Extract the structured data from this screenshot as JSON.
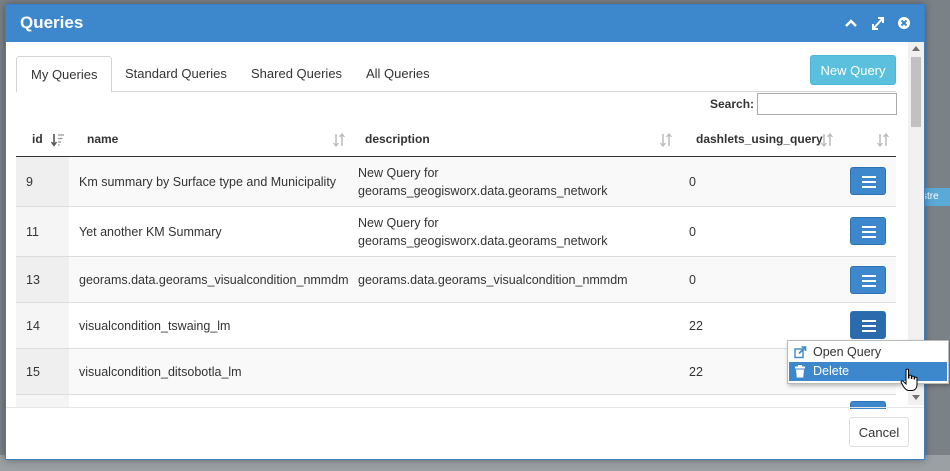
{
  "dialog": {
    "title": "Queries"
  },
  "background": {
    "tag_text": "stre"
  },
  "tabs": [
    {
      "label": "My Queries",
      "active": true
    },
    {
      "label": "Standard Queries",
      "active": false
    },
    {
      "label": "Shared Queries",
      "active": false
    },
    {
      "label": "All Queries",
      "active": false
    }
  ],
  "toolbar": {
    "new_query_label": "New Query"
  },
  "search": {
    "label": "Search:",
    "value": ""
  },
  "table": {
    "columns": [
      "id",
      "name",
      "description",
      "dashlets_using_query"
    ],
    "rows": [
      {
        "id": "9",
        "name": "Km summary by Surface type and Municipality",
        "description_1": "New Query for",
        "description_2": "georams_geogisworx.data.georams_network",
        "dashlets": "0"
      },
      {
        "id": "11",
        "name": "Yet another KM Summary",
        "description_1": "New Query for",
        "description_2": "georams_geogisworx.data.georams_network",
        "dashlets": "0"
      },
      {
        "id": "13",
        "name": "georams.data.georams_visualcondition_nmmdm",
        "description_1": "georams.data.georams_visualcondition_nmmdm",
        "description_2": "",
        "dashlets": "0"
      },
      {
        "id": "14",
        "name": "visualcondition_tswaing_lm",
        "description_1": "",
        "description_2": "",
        "dashlets": "22"
      },
      {
        "id": "15",
        "name": "visualcondition_ditsobotla_lm",
        "description_1": "",
        "description_2": "",
        "dashlets": "22"
      }
    ]
  },
  "context_menu": {
    "items": [
      {
        "label": "Open Query",
        "icon": "external-link-icon"
      },
      {
        "label": "Delete",
        "icon": "trash-icon"
      }
    ]
  },
  "footer": {
    "cancel_label": "Cancel"
  },
  "colors": {
    "header": "#3d87cc",
    "new_query": "#5bc0de",
    "action_button": "#3d87cc"
  }
}
